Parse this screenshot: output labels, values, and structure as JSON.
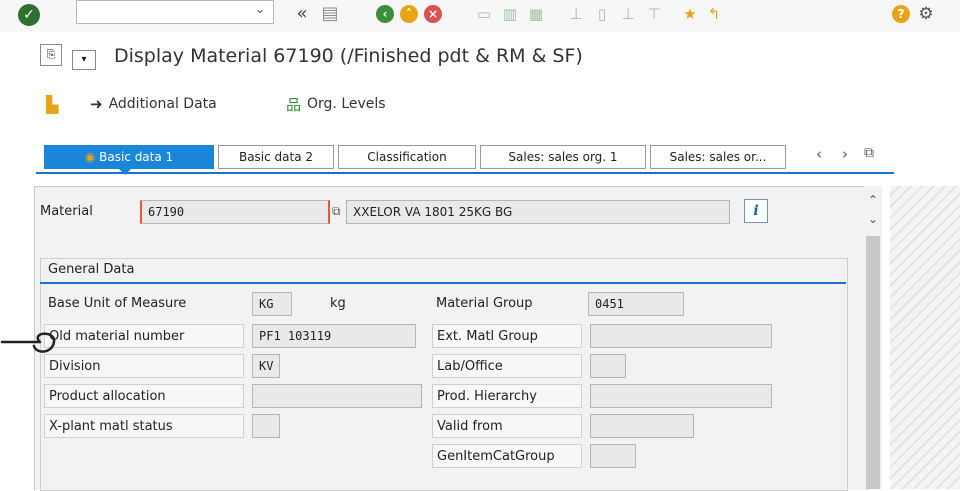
{
  "toolbar": {
    "command_field_value": "",
    "dropdown_glyph": "⌄",
    "nav_back_glyph": "«",
    "save_glyph": "▤",
    "icons": [
      "check-icon",
      "back-icon",
      "exit-icon",
      "cancel-icon",
      "print-icon",
      "find-icon",
      "find-next-icon",
      "first-page-icon",
      "prev-page-icon",
      "next-page-icon",
      "last-page-icon",
      "create-session-icon",
      "shortcut-icon",
      "help-icon",
      "settings-icon"
    ],
    "colors": {
      "check": "#2f6f2f",
      "back": "#3a8f3a",
      "exit": "#e8a417",
      "cancel": "#d9534f",
      "help": "#e8a417"
    }
  },
  "title": {
    "text": "Display Material 67190 (/Finished pdt & RM & SF)"
  },
  "app_toolbar": {
    "additional_data": "Additional Data",
    "org_levels": "Org. Levels"
  },
  "tabs": [
    {
      "label": "Basic data 1",
      "active": true
    },
    {
      "label": "Basic data 2",
      "active": false
    },
    {
      "label": "Classification",
      "active": false
    },
    {
      "label": "Sales: sales org. 1",
      "active": false
    },
    {
      "label": "Sales: sales or...",
      "active": false
    }
  ],
  "material": {
    "label": "Material",
    "number": "67190",
    "description": "XXELOR VA 1801 25KG BG",
    "info_glyph": "i"
  },
  "general_data": {
    "title": "General Data",
    "rows_left": [
      {
        "label": "Base Unit of Measure",
        "value": "KG",
        "extra": "kg"
      },
      {
        "label": "Old material number",
        "value": "PF1 103119"
      },
      {
        "label": "Division",
        "value": "KV"
      },
      {
        "label": "Product allocation",
        "value": ""
      },
      {
        "label": "X-plant matl status",
        "value": ""
      }
    ],
    "rows_right": [
      {
        "label": "Material Group",
        "value": "0451"
      },
      {
        "label": "Ext. Matl Group",
        "value": ""
      },
      {
        "label": "Lab/Office",
        "value": ""
      },
      {
        "label": "Prod. Hierarchy",
        "value": ""
      },
      {
        "label": "Valid from",
        "value": ""
      },
      {
        "label": "GenItemCatGroup",
        "value": ""
      }
    ]
  },
  "accent_color": "#1a86d9"
}
